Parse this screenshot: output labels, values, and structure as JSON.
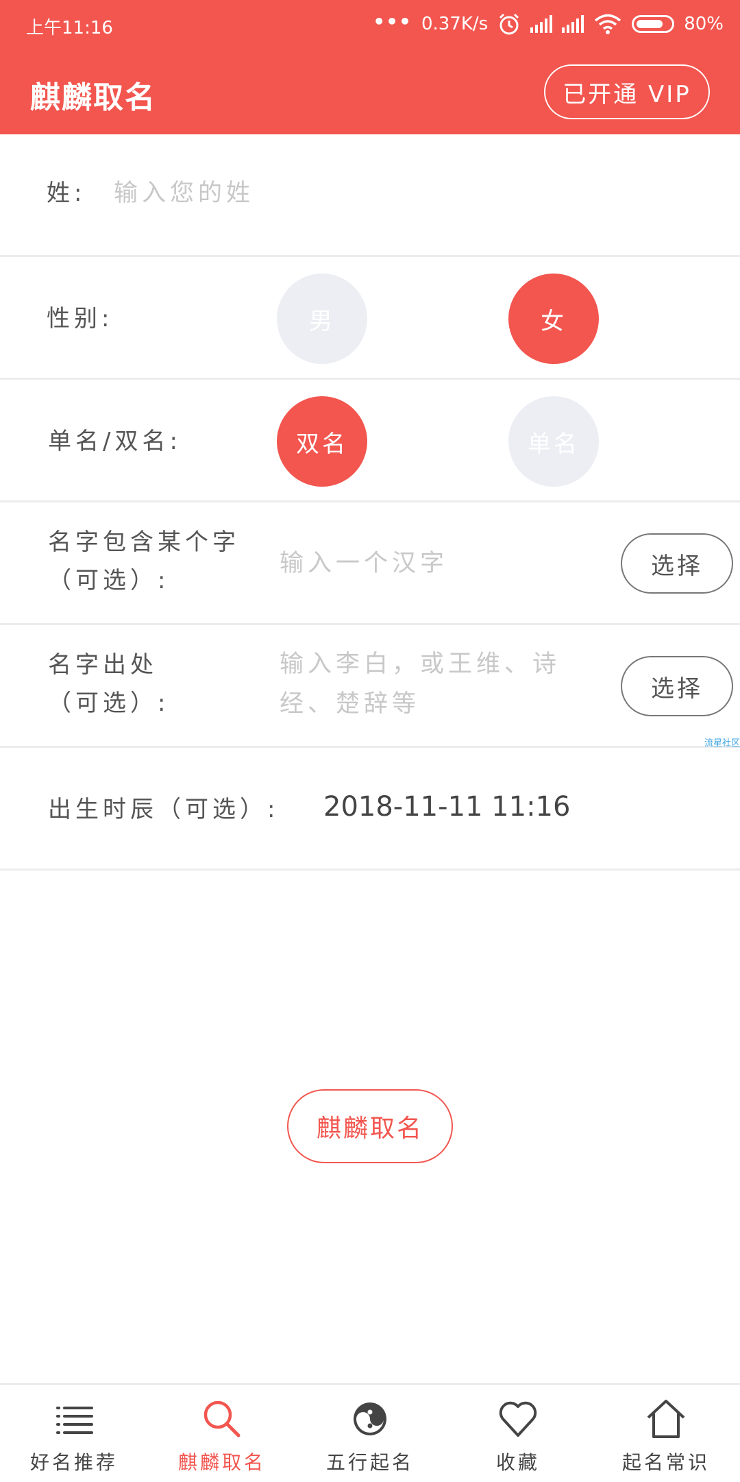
{
  "status_bar": {
    "time": "上午11:16",
    "dots": "•••",
    "net_speed": "0.37K/s",
    "battery": "80%",
    "battery_level": 0.8,
    "icons": [
      "alarm-icon",
      "signal-icon",
      "signal-icon",
      "wifi-icon",
      "battery-icon"
    ]
  },
  "app_bar": {
    "title": "麒麟取名",
    "vip_button": "已开通 VIP"
  },
  "form": {
    "surname_label": "姓:",
    "surname_placeholder": "输入您的姓",
    "gender_label": "性别:",
    "gender_options": [
      "男",
      "女"
    ],
    "gender_selected": "女",
    "name_length_label": "单名/双名:",
    "name_length_options": [
      "双名",
      "单名"
    ],
    "name_length_selected": "双名",
    "contains_char_label_line1": "名字包含某个字",
    "contains_char_label_line2": "（可选）:",
    "contains_char_placeholder": "输入一个汉字",
    "contains_char_button": "选择",
    "source_label_line1": "名字出处",
    "source_label_line2": "（可选）:",
    "source_placeholder_line1": "输入李白，或王维、诗",
    "source_placeholder_line2": "经、楚辞等",
    "source_button": "选择",
    "watermark": "流星社区",
    "birth_label": "出生时辰（可选）:",
    "birth_value": "2018-11-11 11:16"
  },
  "main_button": "麒麟取名",
  "colors": {
    "accent": "#f2564f",
    "unselected": "#eceef3",
    "placeholder": "#c8c8c8"
  },
  "tabs": [
    {
      "label": "好名推荐",
      "icon": "list-icon",
      "active": false
    },
    {
      "label": "麒麟取名",
      "icon": "search-icon",
      "active": true
    },
    {
      "label": "五行起名",
      "icon": "yin-yang-icon",
      "active": false
    },
    {
      "label": "收藏",
      "icon": "heart-icon",
      "active": false
    },
    {
      "label": "起名常识",
      "icon": "home-icon",
      "active": false
    }
  ]
}
